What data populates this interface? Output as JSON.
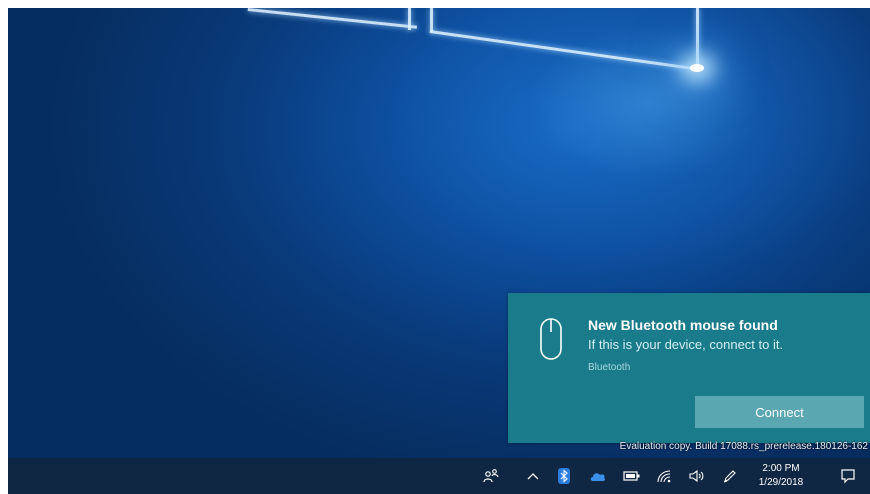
{
  "notification": {
    "title": "New Bluetooth mouse found",
    "body": "If this is your device, connect to it.",
    "source": "Bluetooth",
    "action_label": "Connect",
    "icon": "mouse-icon",
    "accent_color": "#1a7b8b"
  },
  "watermark": {
    "text": "Evaluation copy. Build 17088.rs_prerelease.180126-162"
  },
  "taskbar": {
    "tray_icons": [
      "people-icon",
      "show-hidden-icons-chevron",
      "bluetooth-icon",
      "onedrive-icon",
      "battery-icon",
      "wifi-icon",
      "volume-icon",
      "pen-icon"
    ],
    "clock": {
      "time": "2:00 PM",
      "date": "1/29/2018"
    },
    "action_center_icon": "action-center-icon"
  },
  "colors": {
    "wallpaper": "#0d4f9f",
    "taskbar": "#0f2742",
    "button": "#5aa6b1"
  }
}
